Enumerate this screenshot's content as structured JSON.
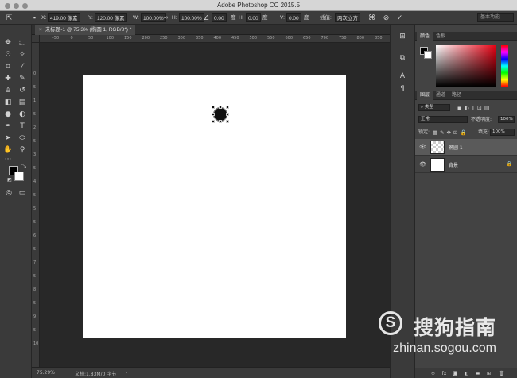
{
  "window": {
    "title": "Adobe Photoshop CC 2015.5"
  },
  "options_bar": {
    "x_label": "X:",
    "x_value": "419.00 像素",
    "y_label": "Y:",
    "y_value": "120.00 像素",
    "w_label": "W:",
    "w_value": "100.00%",
    "h_label": "H:",
    "h_value": "100.00%",
    "angle_value": "0.00",
    "angle_unit": "度",
    "hskew_label": "H:",
    "hskew_value": "0.00",
    "hskew_unit": "度",
    "vskew_label": "V:",
    "vskew_value": "0.00",
    "vskew_unit": "度",
    "interp_label": "插值:",
    "interp_value": "两次立方",
    "workspace": "基本功能"
  },
  "document": {
    "tab_title": "未标题-1 @ 75.3% (椭圆 1, RGB/8*) *"
  },
  "rulers": {
    "h_ticks": [
      "-50",
      "0",
      "50",
      "100",
      "150",
      "200",
      "250",
      "300",
      "350",
      "400",
      "450",
      "500",
      "550",
      "600",
      "650",
      "700",
      "750",
      "800",
      "850",
      "900"
    ],
    "v_ticks": [
      "0",
      "5",
      "1",
      "5",
      "2",
      "5",
      "3",
      "5",
      "4",
      "5",
      "5",
      "5",
      "6",
      "5",
      "7",
      "5",
      "8",
      "5",
      "9",
      "5",
      "10"
    ]
  },
  "status": {
    "zoom": "75.29%",
    "doc_info": "文档:1.83M/0 字节"
  },
  "color_panel": {
    "tabs": [
      "颜色",
      "色板"
    ]
  },
  "layers_panel": {
    "tabs": [
      "图层",
      "通道",
      "路径"
    ],
    "filter_label": "类型",
    "blend_mode": "正常",
    "opacity_label": "不透明度:",
    "opacity_value": "100%",
    "lock_label": "锁定:",
    "fill_label": "填充:",
    "fill_value": "100%",
    "layers": [
      {
        "name": "椭圆 1",
        "selected": true
      },
      {
        "name": "背景",
        "selected": false
      }
    ]
  },
  "watermark": {
    "brand": "搜狗指南",
    "url": "zhinan.sogou.com"
  },
  "colors": {
    "accent_red": "#e60012",
    "canvas_bg": "#282828",
    "panel_bg": "#434343"
  }
}
